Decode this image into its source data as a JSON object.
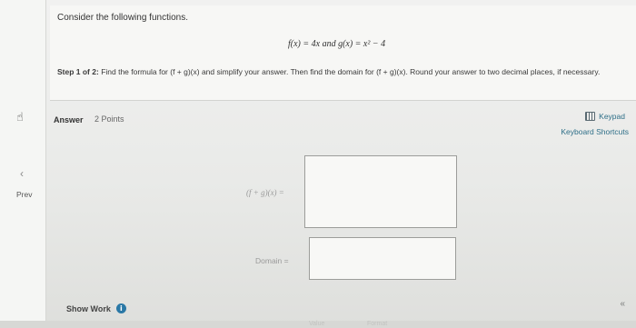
{
  "question": {
    "intro": "Consider the following functions.",
    "functions": "f(x) = 4x and g(x) = x² − 4",
    "step_label": "Step 1 of 2:",
    "step_text": "Find the formula for (f + g)(x) and simplify your answer. Then find the domain for (f + g)(x). Round your answer to two decimal places, if necessary."
  },
  "answer": {
    "label": "Answer",
    "points": "2 Points",
    "keypad_label": "Keypad",
    "shortcuts_label": "Keyboard Shortcuts",
    "sum_label": "(f + g)(x) =",
    "domain_label": "Domain ="
  },
  "sidebar": {
    "prev_label": "Prev"
  },
  "footer": {
    "show_work_label": "Show Work",
    "info_glyph": "i",
    "ghost_1": "Value",
    "ghost_2": "Format"
  },
  "icons": {
    "rail_icon": "hand-pointer-icon",
    "prev_icon": "chevron-left-icon",
    "keypad_icon": "keypad-icon",
    "expand_icon": "double-chevron-icon",
    "info_icon": "info-icon"
  },
  "colors": {
    "link": "#2e6f88",
    "info": "#2a78a6"
  }
}
